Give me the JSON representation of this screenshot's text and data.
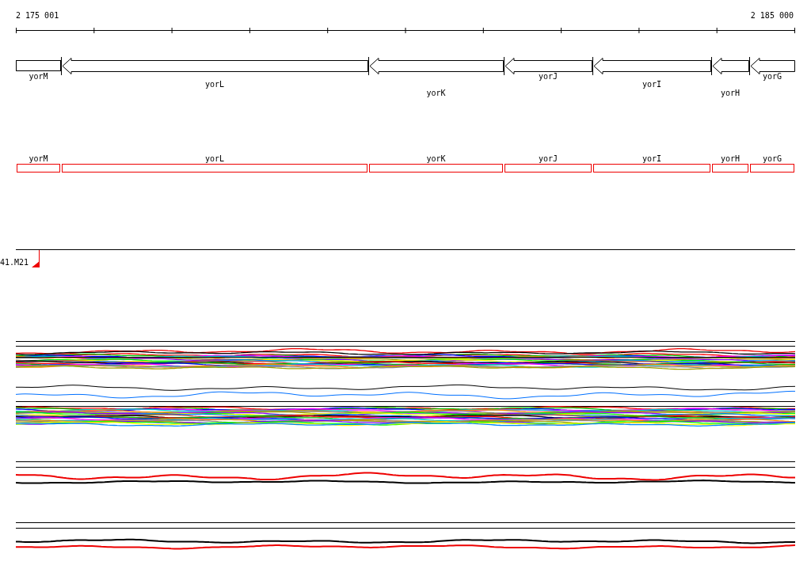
{
  "ruler": {
    "start_label": "2 175 001",
    "end_label": "2 185 000"
  },
  "genes": [
    {
      "name": "yorM",
      "kind": "box"
    },
    {
      "name": "yorL",
      "kind": "arrow"
    },
    {
      "name": "yorK",
      "kind": "arrow"
    },
    {
      "name": "yorJ",
      "kind": "arrow"
    },
    {
      "name": "yorI",
      "kind": "arrow"
    },
    {
      "name": "yorH",
      "kind": "arrow"
    },
    {
      "name": "yorG",
      "kind": "arrow"
    }
  ],
  "gene_boxes": [
    {
      "name": "yorM"
    },
    {
      "name": "yorL"
    },
    {
      "name": "yorK"
    },
    {
      "name": "yorJ"
    },
    {
      "name": "yorI"
    },
    {
      "name": "yorH"
    },
    {
      "name": "yorG"
    }
  ],
  "track_label": "41.M21"
}
